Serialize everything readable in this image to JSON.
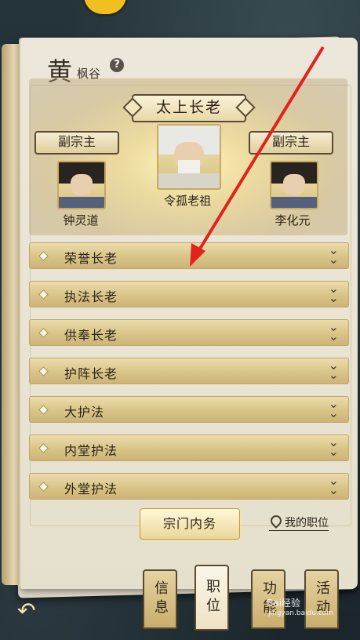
{
  "header": {
    "surname_char": "黄",
    "sect_name": "枫谷",
    "help_icon": "?"
  },
  "hierarchy": {
    "top_title": "太上长老",
    "elder_name": "令孤老祖",
    "left_title": "副宗主",
    "left_name": "钟灵道",
    "right_title": "副宗主",
    "right_name": "李化元"
  },
  "ranks": [
    {
      "label": "荣誉长老"
    },
    {
      "label": "执法长老"
    },
    {
      "label": "供奉长老"
    },
    {
      "label": "护阵长老"
    },
    {
      "label": "大护法"
    },
    {
      "label": "内堂护法"
    },
    {
      "label": "外堂护法"
    }
  ],
  "actions": {
    "affairs_label": "宗门内务",
    "my_position_label": "我的职位"
  },
  "tabs": [
    {
      "label": "信息"
    },
    {
      "label": "职位"
    },
    {
      "label": "功能"
    },
    {
      "label": "活动"
    }
  ],
  "watermark": {
    "text": "Bai经验",
    "site": "jingyan.baidu.com"
  },
  "colors": {
    "annotation_arrow": "#e0231c",
    "row_gold": "#d9c488",
    "page_paper": "#ece7da"
  }
}
